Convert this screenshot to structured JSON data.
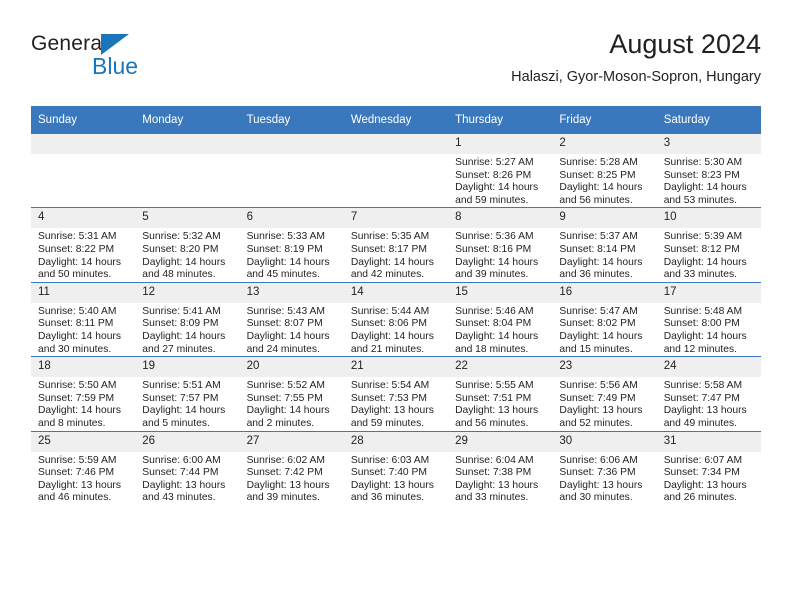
{
  "brand": {
    "name_top": "General",
    "name_bottom": "Blue",
    "triangle_color": "#1b75bb"
  },
  "header": {
    "title": "August 2024",
    "subtitle": "Halaszi, Gyor-Moson-Sopron, Hungary",
    "accent_color": "#3a78bd",
    "daynum_bg": "#efefef"
  },
  "weekday_headers": [
    "Sunday",
    "Monday",
    "Tuesday",
    "Wednesday",
    "Thursday",
    "Friday",
    "Saturday"
  ],
  "labels": {
    "sunrise_prefix": "Sunrise:",
    "sunset_prefix": "Sunset:",
    "daylight_prefix": "Daylight:"
  },
  "weeks": [
    [
      {
        "day": "",
        "empty": true
      },
      {
        "day": "",
        "empty": true
      },
      {
        "day": "",
        "empty": true
      },
      {
        "day": "",
        "empty": true
      },
      {
        "day": "1",
        "sunrise": "Sunrise: 5:27 AM",
        "sunset": "Sunset: 8:26 PM",
        "daylight_line1": "Daylight: 14 hours",
        "daylight_line2": "and 59 minutes."
      },
      {
        "day": "2",
        "sunrise": "Sunrise: 5:28 AM",
        "sunset": "Sunset: 8:25 PM",
        "daylight_line1": "Daylight: 14 hours",
        "daylight_line2": "and 56 minutes."
      },
      {
        "day": "3",
        "sunrise": "Sunrise: 5:30 AM",
        "sunset": "Sunset: 8:23 PM",
        "daylight_line1": "Daylight: 14 hours",
        "daylight_line2": "and 53 minutes."
      }
    ],
    [
      {
        "day": "4",
        "sunrise": "Sunrise: 5:31 AM",
        "sunset": "Sunset: 8:22 PM",
        "daylight_line1": "Daylight: 14 hours",
        "daylight_line2": "and 50 minutes."
      },
      {
        "day": "5",
        "sunrise": "Sunrise: 5:32 AM",
        "sunset": "Sunset: 8:20 PM",
        "daylight_line1": "Daylight: 14 hours",
        "daylight_line2": "and 48 minutes."
      },
      {
        "day": "6",
        "sunrise": "Sunrise: 5:33 AM",
        "sunset": "Sunset: 8:19 PM",
        "daylight_line1": "Daylight: 14 hours",
        "daylight_line2": "and 45 minutes."
      },
      {
        "day": "7",
        "sunrise": "Sunrise: 5:35 AM",
        "sunset": "Sunset: 8:17 PM",
        "daylight_line1": "Daylight: 14 hours",
        "daylight_line2": "and 42 minutes."
      },
      {
        "day": "8",
        "sunrise": "Sunrise: 5:36 AM",
        "sunset": "Sunset: 8:16 PM",
        "daylight_line1": "Daylight: 14 hours",
        "daylight_line2": "and 39 minutes."
      },
      {
        "day": "9",
        "sunrise": "Sunrise: 5:37 AM",
        "sunset": "Sunset: 8:14 PM",
        "daylight_line1": "Daylight: 14 hours",
        "daylight_line2": "and 36 minutes."
      },
      {
        "day": "10",
        "sunrise": "Sunrise: 5:39 AM",
        "sunset": "Sunset: 8:12 PM",
        "daylight_line1": "Daylight: 14 hours",
        "daylight_line2": "and 33 minutes."
      }
    ],
    [
      {
        "day": "11",
        "sunrise": "Sunrise: 5:40 AM",
        "sunset": "Sunset: 8:11 PM",
        "daylight_line1": "Daylight: 14 hours",
        "daylight_line2": "and 30 minutes."
      },
      {
        "day": "12",
        "sunrise": "Sunrise: 5:41 AM",
        "sunset": "Sunset: 8:09 PM",
        "daylight_line1": "Daylight: 14 hours",
        "daylight_line2": "and 27 minutes."
      },
      {
        "day": "13",
        "sunrise": "Sunrise: 5:43 AM",
        "sunset": "Sunset: 8:07 PM",
        "daylight_line1": "Daylight: 14 hours",
        "daylight_line2": "and 24 minutes."
      },
      {
        "day": "14",
        "sunrise": "Sunrise: 5:44 AM",
        "sunset": "Sunset: 8:06 PM",
        "daylight_line1": "Daylight: 14 hours",
        "daylight_line2": "and 21 minutes."
      },
      {
        "day": "15",
        "sunrise": "Sunrise: 5:46 AM",
        "sunset": "Sunset: 8:04 PM",
        "daylight_line1": "Daylight: 14 hours",
        "daylight_line2": "and 18 minutes."
      },
      {
        "day": "16",
        "sunrise": "Sunrise: 5:47 AM",
        "sunset": "Sunset: 8:02 PM",
        "daylight_line1": "Daylight: 14 hours",
        "daylight_line2": "and 15 minutes."
      },
      {
        "day": "17",
        "sunrise": "Sunrise: 5:48 AM",
        "sunset": "Sunset: 8:00 PM",
        "daylight_line1": "Daylight: 14 hours",
        "daylight_line2": "and 12 minutes."
      }
    ],
    [
      {
        "day": "18",
        "sunrise": "Sunrise: 5:50 AM",
        "sunset": "Sunset: 7:59 PM",
        "daylight_line1": "Daylight: 14 hours",
        "daylight_line2": "and 8 minutes."
      },
      {
        "day": "19",
        "sunrise": "Sunrise: 5:51 AM",
        "sunset": "Sunset: 7:57 PM",
        "daylight_line1": "Daylight: 14 hours",
        "daylight_line2": "and 5 minutes."
      },
      {
        "day": "20",
        "sunrise": "Sunrise: 5:52 AM",
        "sunset": "Sunset: 7:55 PM",
        "daylight_line1": "Daylight: 14 hours",
        "daylight_line2": "and 2 minutes."
      },
      {
        "day": "21",
        "sunrise": "Sunrise: 5:54 AM",
        "sunset": "Sunset: 7:53 PM",
        "daylight_line1": "Daylight: 13 hours",
        "daylight_line2": "and 59 minutes."
      },
      {
        "day": "22",
        "sunrise": "Sunrise: 5:55 AM",
        "sunset": "Sunset: 7:51 PM",
        "daylight_line1": "Daylight: 13 hours",
        "daylight_line2": "and 56 minutes."
      },
      {
        "day": "23",
        "sunrise": "Sunrise: 5:56 AM",
        "sunset": "Sunset: 7:49 PM",
        "daylight_line1": "Daylight: 13 hours",
        "daylight_line2": "and 52 minutes."
      },
      {
        "day": "24",
        "sunrise": "Sunrise: 5:58 AM",
        "sunset": "Sunset: 7:47 PM",
        "daylight_line1": "Daylight: 13 hours",
        "daylight_line2": "and 49 minutes."
      }
    ],
    [
      {
        "day": "25",
        "sunrise": "Sunrise: 5:59 AM",
        "sunset": "Sunset: 7:46 PM",
        "daylight_line1": "Daylight: 13 hours",
        "daylight_line2": "and 46 minutes."
      },
      {
        "day": "26",
        "sunrise": "Sunrise: 6:00 AM",
        "sunset": "Sunset: 7:44 PM",
        "daylight_line1": "Daylight: 13 hours",
        "daylight_line2": "and 43 minutes."
      },
      {
        "day": "27",
        "sunrise": "Sunrise: 6:02 AM",
        "sunset": "Sunset: 7:42 PM",
        "daylight_line1": "Daylight: 13 hours",
        "daylight_line2": "and 39 minutes."
      },
      {
        "day": "28",
        "sunrise": "Sunrise: 6:03 AM",
        "sunset": "Sunset: 7:40 PM",
        "daylight_line1": "Daylight: 13 hours",
        "daylight_line2": "and 36 minutes."
      },
      {
        "day": "29",
        "sunrise": "Sunrise: 6:04 AM",
        "sunset": "Sunset: 7:38 PM",
        "daylight_line1": "Daylight: 13 hours",
        "daylight_line2": "and 33 minutes."
      },
      {
        "day": "30",
        "sunrise": "Sunrise: 6:06 AM",
        "sunset": "Sunset: 7:36 PM",
        "daylight_line1": "Daylight: 13 hours",
        "daylight_line2": "and 30 minutes."
      },
      {
        "day": "31",
        "sunrise": "Sunrise: 6:07 AM",
        "sunset": "Sunset: 7:34 PM",
        "daylight_line1": "Daylight: 13 hours",
        "daylight_line2": "and 26 minutes."
      }
    ]
  ]
}
